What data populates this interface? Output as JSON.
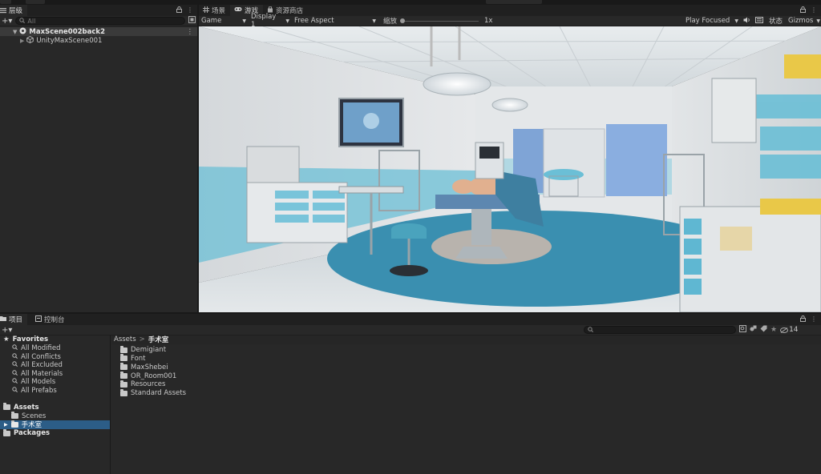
{
  "hierarchy": {
    "tab_label": "层级",
    "search_placeholder": "All",
    "scene_name": "MaxScene002back2",
    "child_name": "UnityMaxScene001"
  },
  "game": {
    "tab_scene": "场景",
    "tab_game": "游戏",
    "tab_store": "资源商店",
    "display_mode": "Game",
    "display": "Display 1",
    "aspect": "Free Aspect",
    "scale_label": "缩放",
    "scale_value": "1x",
    "play_mode": "Play Focused",
    "stats_label": "状态",
    "gizmos_label": "Gizmos"
  },
  "project": {
    "tab_project": "项目",
    "tab_console": "控制台",
    "hidden_count": "14",
    "favorites_label": "Favorites",
    "favorites": [
      "All Modified",
      "All Conflicts",
      "All Excluded",
      "All Materials",
      "All Models",
      "All Prefabs"
    ],
    "assets_label": "Assets",
    "asset_tree": [
      "Scenes",
      "手术室"
    ],
    "packages_label": "Packages",
    "breadcrumb_root": "Assets",
    "breadcrumb_sep": ">",
    "breadcrumb_current": "手术室",
    "folders": [
      "Demigiant",
      "Font",
      "MaxShebei",
      "OR_Room001",
      "Resources",
      "Standard Assets"
    ]
  },
  "colors": {
    "selection": "#2c5d87",
    "panel": "#282828",
    "floor_circle": "#3a8fb0"
  }
}
